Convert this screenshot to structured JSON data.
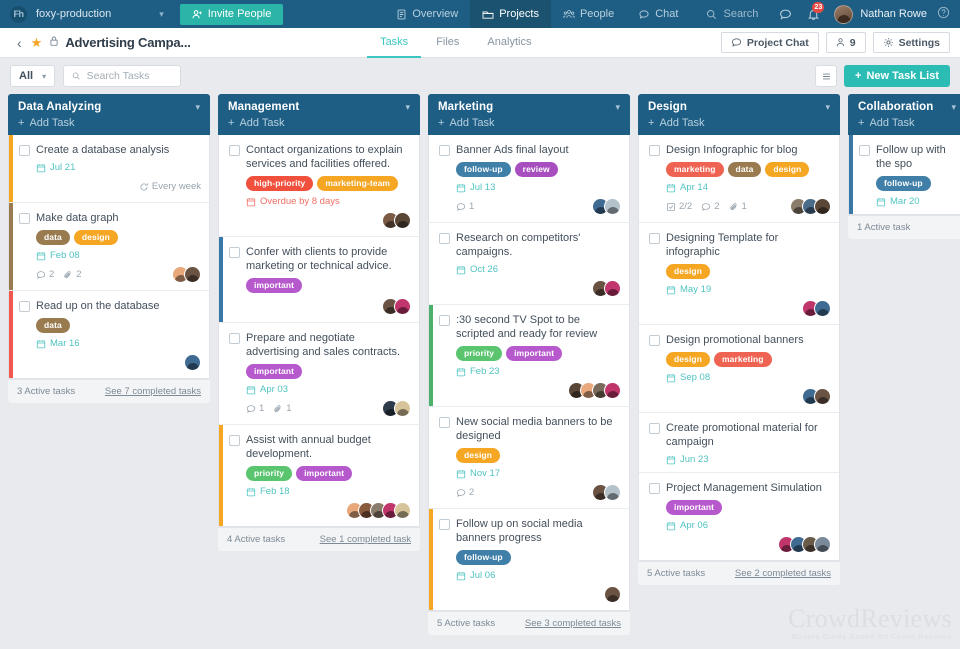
{
  "topbar": {
    "logo_text": "Fh",
    "org": "foxy-production",
    "invite_label": "Invite People",
    "nav": [
      {
        "label": "Overview",
        "icon": "document-icon",
        "active": false
      },
      {
        "label": "Projects",
        "icon": "folder-icon",
        "active": true
      },
      {
        "label": "People",
        "icon": "people-icon",
        "active": false
      },
      {
        "label": "Chat",
        "icon": "chat-icon",
        "active": false
      }
    ],
    "search_label": "Search",
    "notification_count": "23",
    "user_name": "Nathan Rowe"
  },
  "project_header": {
    "title": "Advertising Campa...",
    "tabs": [
      {
        "label": "Tasks",
        "active": true
      },
      {
        "label": "Files",
        "active": false
      },
      {
        "label": "Analytics",
        "active": false
      }
    ],
    "project_chat_label": "Project Chat",
    "members_count": "9",
    "settings_label": "Settings"
  },
  "filterbar": {
    "filter_label": "All",
    "search_placeholder": "Search Tasks",
    "new_task_list_label": "New Task List"
  },
  "colors": {
    "brand_teal": "#2bbdb4",
    "header_blue": "#1f5e84",
    "date_teal": "#4fc3c0",
    "overdue_red": "#ef6f63",
    "tag_data": "#9a7b4f",
    "tag_design": "#f5a623",
    "tag_marketing": "#ef6352",
    "tag_important": "#b659cc",
    "tag_priority": "#5ac46f",
    "tag_follow_up": "#3f7fa8",
    "tag_review": "#a84fc0",
    "tag_high_priority": "#f0503c",
    "tag_marketing_team": "#f5a623"
  },
  "columns": [
    {
      "title": "Data Analyzing",
      "add_task_label": "Add Task",
      "active_text": "3 Active tasks",
      "completed_text": "See 7 completed tasks",
      "cards": [
        {
          "title": "Create a database analysis",
          "stripe": "#f5a623",
          "tags": [],
          "date": "Jul 21",
          "overdue": false,
          "repeat": "Every week",
          "stats": [],
          "avatars": []
        },
        {
          "title": "Make data graph",
          "stripe": "#9a7b4f",
          "tags": [
            {
              "label": "data",
              "color": "#9a7b4f"
            },
            {
              "label": "design",
              "color": "#f5a623"
            }
          ],
          "date": "Feb 08",
          "overdue": false,
          "repeat": "",
          "stats": [
            {
              "icon": "comment-icon",
              "value": "2"
            },
            {
              "icon": "attachment-icon",
              "value": "2"
            }
          ],
          "avatars": [
            "#e8a87c",
            "#6b5344"
          ]
        },
        {
          "title": "Read up on the database",
          "stripe": "#f2584f",
          "tags": [
            {
              "label": "data",
              "color": "#9a7b4f"
            }
          ],
          "date": "Mar 16",
          "overdue": false,
          "repeat": "",
          "stats": [],
          "avatars": [
            "#3f6b92"
          ]
        }
      ]
    },
    {
      "title": "Management",
      "add_task_label": "Add Task",
      "active_text": "4 Active tasks",
      "completed_text": "See 1 completed task",
      "cards": [
        {
          "title": "Contact organizations to explain services and facilities offered.",
          "stripe": "",
          "tags": [
            {
              "label": "high-priority",
              "color": "#f0503c"
            },
            {
              "label": "marketing-team",
              "color": "#f5a623"
            }
          ],
          "date": "Overdue by 8 days",
          "overdue": true,
          "repeat": "",
          "stats": [],
          "avatars": [
            "#7a5c46",
            "#5a4636"
          ]
        },
        {
          "title": "Confer with clients to provide marketing or technical advice.",
          "stripe": "#3a78a8",
          "tags": [
            {
              "label": "important",
              "color": "#b659cc"
            }
          ],
          "date": "",
          "overdue": false,
          "repeat": "",
          "stats": [],
          "avatars": [
            "#6b5344",
            "#c0356c"
          ]
        },
        {
          "title": "Prepare and negotiate advertising and sales contracts.",
          "stripe": "",
          "tags": [
            {
              "label": "important",
              "color": "#b659cc"
            }
          ],
          "date": "Apr 03",
          "overdue": false,
          "repeat": "",
          "stats": [
            {
              "icon": "comment-icon",
              "value": "1"
            },
            {
              "icon": "attachment-icon",
              "value": "1"
            }
          ],
          "avatars": [
            "#2e3b4a",
            "#d8c49a"
          ]
        },
        {
          "title": "Assist with annual budget development.",
          "stripe": "#f5a623",
          "tags": [
            {
              "label": "priority",
              "color": "#5ac46f"
            },
            {
              "label": "important",
              "color": "#b659cc"
            }
          ],
          "date": "Feb 18",
          "overdue": false,
          "repeat": "",
          "stats": [],
          "avatars": [
            "#e8a87c",
            "#8a5a3c",
            "#8a7c6a",
            "#c0356c",
            "#d8c49a"
          ]
        }
      ]
    },
    {
      "title": "Marketing",
      "add_task_label": "Add Task",
      "active_text": "5 Active tasks",
      "completed_text": "See 3 completed tasks",
      "cards": [
        {
          "title": "Banner Ads final layout",
          "stripe": "",
          "tags": [
            {
              "label": "follow-up",
              "color": "#3f7fa8"
            },
            {
              "label": "review",
              "color": "#a84fc0"
            }
          ],
          "date": "Jul 13",
          "overdue": false,
          "repeat": "",
          "stats": [
            {
              "icon": "comment-icon",
              "value": "1"
            }
          ],
          "avatars": [
            "#3f6b92",
            "#b4c2cc"
          ]
        },
        {
          "title": "Research on competitors' campaigns.",
          "stripe": "",
          "tags": [],
          "date": "Oct 26",
          "overdue": false,
          "repeat": "",
          "stats": [],
          "avatars": [
            "#6b5344",
            "#c0356c"
          ]
        },
        {
          "title": ":30 second TV Spot to be scripted and ready for review",
          "stripe": "#4caf6a",
          "tags": [
            {
              "label": "priority",
              "color": "#5ac46f"
            },
            {
              "label": "important",
              "color": "#b659cc"
            }
          ],
          "date": "Feb 23",
          "overdue": false,
          "repeat": "",
          "stats": [],
          "avatars": [
            "#5a4636",
            "#e8a87c",
            "#7a6a5a",
            "#c0356c"
          ]
        },
        {
          "title": "New social media banners to be designed",
          "stripe": "",
          "tags": [
            {
              "label": "design",
              "color": "#f5a623"
            }
          ],
          "date": "Nov 17",
          "overdue": false,
          "repeat": "",
          "stats": [
            {
              "icon": "comment-icon",
              "value": "2"
            }
          ],
          "avatars": [
            "#6b5344",
            "#b4c2cc"
          ]
        },
        {
          "title": "Follow up on social media banners progress",
          "stripe": "#f5a623",
          "tags": [
            {
              "label": "follow-up",
              "color": "#3f7fa8"
            }
          ],
          "date": "Jul 06",
          "overdue": false,
          "repeat": "",
          "stats": [],
          "avatars": [
            "#6b5344"
          ]
        }
      ]
    },
    {
      "title": "Design",
      "add_task_label": "Add Task",
      "active_text": "5 Active tasks",
      "completed_text": "See 2 completed tasks",
      "cards": [
        {
          "title": "Design Infographic for blog",
          "stripe": "",
          "tags": [
            {
              "label": "marketing",
              "color": "#ef6352"
            },
            {
              "label": "data",
              "color": "#9a7b4f"
            },
            {
              "label": "design",
              "color": "#f5a623"
            }
          ],
          "date": "Apr 14",
          "overdue": false,
          "repeat": "",
          "stats": [
            {
              "icon": "checklist-icon",
              "value": "2/2"
            },
            {
              "icon": "comment-icon",
              "value": "2"
            },
            {
              "icon": "attachment-icon",
              "value": "1"
            }
          ],
          "avatars": [
            "#8a7c6a",
            "#4a6b8a",
            "#5a4636"
          ]
        },
        {
          "title": "Designing Template for infographic",
          "stripe": "",
          "tags": [
            {
              "label": "design",
              "color": "#f5a623"
            }
          ],
          "date": "May 19",
          "overdue": false,
          "repeat": "",
          "stats": [],
          "avatars": [
            "#c0356c",
            "#3f6b92"
          ]
        },
        {
          "title": "Design promotional banners",
          "stripe": "",
          "tags": [
            {
              "label": "design",
              "color": "#f5a623"
            },
            {
              "label": "marketing",
              "color": "#ef6352"
            }
          ],
          "date": "Sep 08",
          "overdue": false,
          "repeat": "",
          "stats": [],
          "avatars": [
            "#3f6b92",
            "#6b5344"
          ]
        },
        {
          "title": "Create promotional material for campaign",
          "stripe": "",
          "tags": [],
          "date": "Jun 23",
          "overdue": false,
          "repeat": "",
          "stats": [],
          "avatars": []
        },
        {
          "title": "Project Management Simulation",
          "stripe": "",
          "tags": [
            {
              "label": "important",
              "color": "#b659cc"
            }
          ],
          "date": "Apr 06",
          "overdue": false,
          "repeat": "",
          "stats": [],
          "avatars": [
            "#c0356c",
            "#3f6b92",
            "#6a5a4a",
            "#7a8a9a"
          ]
        }
      ]
    },
    {
      "title": "Collaboration",
      "add_task_label": "Add Task",
      "active_text": "1 Active task",
      "completed_text": "",
      "cards": [
        {
          "title": "Follow up with the spo",
          "stripe": "#3a78a8",
          "tags": [
            {
              "label": "follow-up",
              "color": "#3f7fa8"
            }
          ],
          "date": "Mar 20",
          "overdue": false,
          "repeat": "",
          "stats": [],
          "avatars": []
        }
      ]
    }
  ],
  "watermark": {
    "line1": "CrowdReviews",
    "line2": "Buyers Guide Based On Client Reviews"
  }
}
